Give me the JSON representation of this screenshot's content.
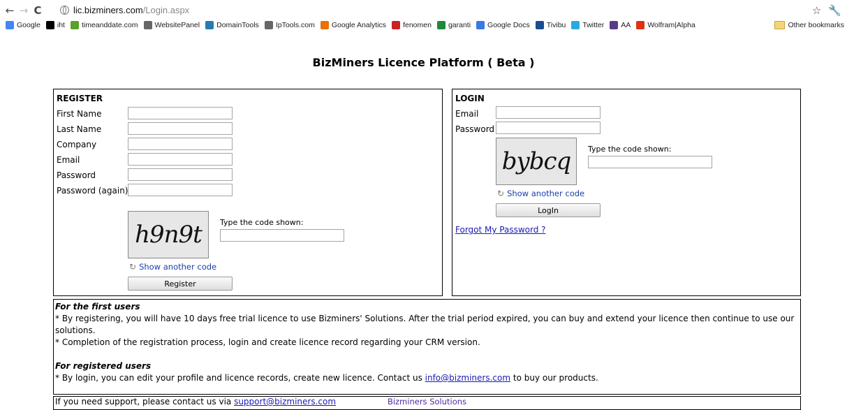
{
  "browser": {
    "url_host": "lic.bizminers.com",
    "url_path": "/Login.aspx",
    "bookmarks": [
      {
        "label": "Google",
        "icon": "google-icon",
        "color": "#4285f4"
      },
      {
        "label": "iht",
        "icon": "iht-icon",
        "color": "#000000"
      },
      {
        "label": "timeanddate.com",
        "icon": "sun-icon",
        "color": "#5aa02c"
      },
      {
        "label": "WebsitePanel",
        "icon": "globe-icon",
        "color": "#666666"
      },
      {
        "label": "DomainTools",
        "icon": "domaintools-icon",
        "color": "#2a7ab0"
      },
      {
        "label": "IpTools.com",
        "icon": "globe-icon",
        "color": "#666666"
      },
      {
        "label": "Google Analytics",
        "icon": "analytics-icon",
        "color": "#e8710a"
      },
      {
        "label": "fenomen",
        "icon": "arrow-icon",
        "color": "#cc2222"
      },
      {
        "label": "garanti",
        "icon": "clover-icon",
        "color": "#1e8a3a"
      },
      {
        "label": "Google Docs",
        "icon": "docs-icon",
        "color": "#3b78e7"
      },
      {
        "label": "Tivibu",
        "icon": "tivibu-icon",
        "color": "#1d4d8f"
      },
      {
        "label": "Twitter",
        "icon": "twitter-icon",
        "color": "#2aa9e0"
      },
      {
        "label": "AA",
        "icon": "aa-icon",
        "color": "#5a3a8a"
      },
      {
        "label": "Wolfram|Alpha",
        "icon": "wolfram-icon",
        "color": "#dd3311"
      }
    ],
    "other_bookmarks": "Other bookmarks"
  },
  "page": {
    "title": "BizMiners Licence Platform ( Beta )"
  },
  "register": {
    "heading": "REGISTER",
    "first_name": "First Name",
    "last_name": "Last Name",
    "company": "Company",
    "email": "Email",
    "password": "Password",
    "password_again": "Password (again)",
    "captcha_text": "h9n9t",
    "captcha_prompt": "Type the code shown:",
    "show_another": "Show another code",
    "button": "Register"
  },
  "login": {
    "heading": "LOGIN",
    "email": "Email",
    "password": "Password",
    "captcha_text": "bybcq",
    "captcha_prompt": "Type the code shown:",
    "show_another": "Show another code",
    "button": "LogIn",
    "forgot": "Forgot My Password ?"
  },
  "info": {
    "first_users_heading": "For the first users",
    "first_users_line1": "* By registering, you will have 10 days free trial licence to use Bizminers' Solutions. After the trial period expired, you can buy and extend your licence then continue to use our solutions.",
    "first_users_line2": "* Completion of the  registration process, login and create licence record regarding your CRM version.",
    "registered_heading": "For registered users",
    "registered_line_pre": "* By login, you can edit your profile and licence records, create new licence. Contact us ",
    "registered_email": "info@bizminers.com",
    "registered_line_post": " to buy our products.",
    "support_pre": "If you need support, please contact us via ",
    "support_email": "support@bizminers.com"
  },
  "footer": {
    "text": "Bizminers Solutions"
  }
}
